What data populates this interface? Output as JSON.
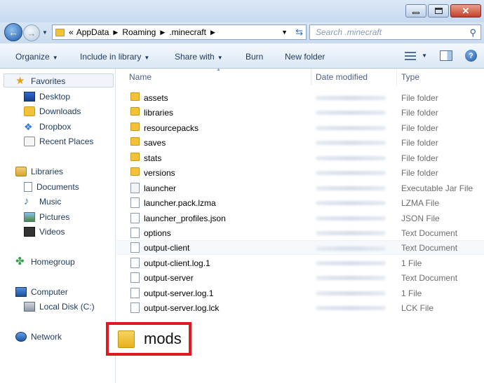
{
  "address_bar": {
    "overflow": "«",
    "crumbs": [
      "AppData",
      "Roaming",
      ".minecraft"
    ]
  },
  "search": {
    "placeholder": "Search .minecraft"
  },
  "toolbar": {
    "organize": "Organize",
    "include_in_library": "Include in library",
    "share_with": "Share with",
    "burn": "Burn",
    "new_folder": "New folder"
  },
  "nav": {
    "favorites": "Favorites",
    "desktop": "Desktop",
    "downloads": "Downloads",
    "dropbox": "Dropbox",
    "recent_places": "Recent Places",
    "libraries": "Libraries",
    "documents": "Documents",
    "music": "Music",
    "pictures": "Pictures",
    "videos": "Videos",
    "homegroup": "Homegroup",
    "computer": "Computer",
    "local_disk": "Local Disk (C:)",
    "network": "Network"
  },
  "columns": {
    "name": "Name",
    "date_modified": "Date modified",
    "type": "Type"
  },
  "files": [
    {
      "name": "assets",
      "type": "File folder",
      "icon": "folder"
    },
    {
      "name": "libraries",
      "type": "File folder",
      "icon": "folder"
    },
    {
      "name": "resourcepacks",
      "type": "File folder",
      "icon": "folder"
    },
    {
      "name": "saves",
      "type": "File folder",
      "icon": "folder"
    },
    {
      "name": "stats",
      "type": "File folder",
      "icon": "folder"
    },
    {
      "name": "versions",
      "type": "File folder",
      "icon": "folder"
    },
    {
      "name": "launcher",
      "type": "Executable Jar File",
      "icon": "jar"
    },
    {
      "name": "launcher.pack.lzma",
      "type": "LZMA File",
      "icon": "file"
    },
    {
      "name": "launcher_profiles.json",
      "type": "JSON File",
      "icon": "file"
    },
    {
      "name": "options",
      "type": "Text Document",
      "icon": "file"
    },
    {
      "name": "output-client",
      "type": "Text Document",
      "icon": "file"
    },
    {
      "name": "output-client.log.1",
      "type": "1 File",
      "icon": "file"
    },
    {
      "name": "output-server",
      "type": "Text Document",
      "icon": "file"
    },
    {
      "name": "output-server.log.1",
      "type": "1 File",
      "icon": "file"
    },
    {
      "name": "output-server.log.lck",
      "type": "LCK File",
      "icon": "file"
    }
  ],
  "highlight": {
    "label": "mods",
    "border_color": "#e0181f"
  }
}
